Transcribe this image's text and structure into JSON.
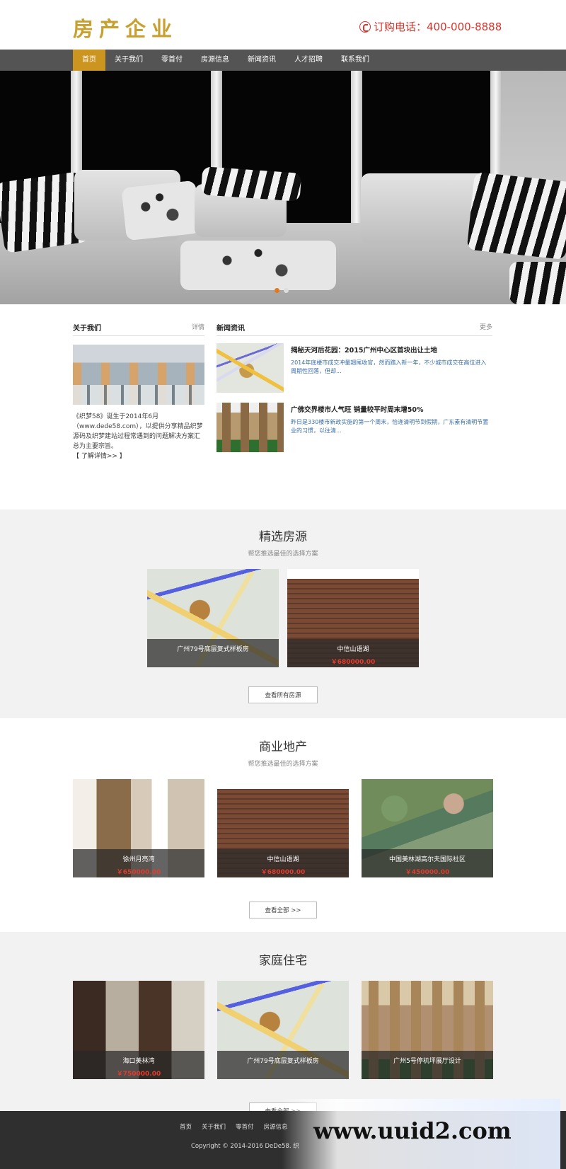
{
  "header": {
    "logo": "房产企业",
    "hotline": "订购电话：400-000-8888"
  },
  "nav": {
    "items": [
      "首页",
      "关于我们",
      "零首付",
      "房源信息",
      "新闻资讯",
      "人才招聘",
      "联系我们"
    ],
    "active": 0
  },
  "about": {
    "title": "关于我们",
    "more": "详情",
    "text": "《织梦58》诞生于2014年6月（www.dede58.com），以提供分享精品织梦源码及织梦建站过程常遇到的问题解决方案汇总为主要宗旨。",
    "link": "【 了解详情>> 】"
  },
  "news": {
    "title": "新闻资讯",
    "more": "更多",
    "items": [
      {
        "title": "揭秘天河后花园：2015广州中心区首块出让土地",
        "summary": "2014年底楼市成交冲量翘尾收官，然而踏入新一年，不少城市成交在高位进入周期性回落，但却..."
      },
      {
        "title": "广佛交界楼市人气旺 销量较平时周末增50%",
        "summary": "昨日是330楼市新政实施的第一个周末，恰逢清明节到假期，广东素有清明节置业的习惯，以往清..."
      }
    ]
  },
  "featured": {
    "title": "精选房源",
    "subtitle": "帮您推选最佳的选择方案",
    "cards": [
      {
        "name": "广州79号底层复式样板房",
        "price": ""
      },
      {
        "name": "中信山语湖",
        "price": "￥680000.00"
      }
    ],
    "button": "查看所有房源"
  },
  "commercial": {
    "title": "商业地产",
    "subtitle": "帮您推选最佳的选择方案",
    "cards": [
      {
        "name": "徐州月亮湾",
        "price": "￥650000.00"
      },
      {
        "name": "中信山语湖",
        "price": "￥680000.00"
      },
      {
        "name": "中国美林湖高尔夫国际社区",
        "price": "￥450000.00"
      }
    ],
    "button": "查看全部 >>"
  },
  "residential": {
    "title": "家庭住宅",
    "cards": [
      {
        "name": "海口美林湾",
        "price": "￥750000.00"
      },
      {
        "name": "广州79号底层复式样板房",
        "price": ""
      },
      {
        "name": "广州5号停机坪展厅设计",
        "price": ""
      }
    ],
    "button": "查看全部 >>"
  },
  "footer": {
    "links": [
      "首页",
      "关于我们",
      "零首付",
      "房源信息"
    ],
    "copyright": "Copyright © 2014-2016 DeDe58. 织"
  },
  "watermark": "www.uuid2.com",
  "colors": {
    "brand_gold": "#cc951f",
    "hotline_red": "#d9342b",
    "price_red": "#e33b2e",
    "nav_bg": "#545454",
    "footer_bg": "#2f2f2f"
  }
}
